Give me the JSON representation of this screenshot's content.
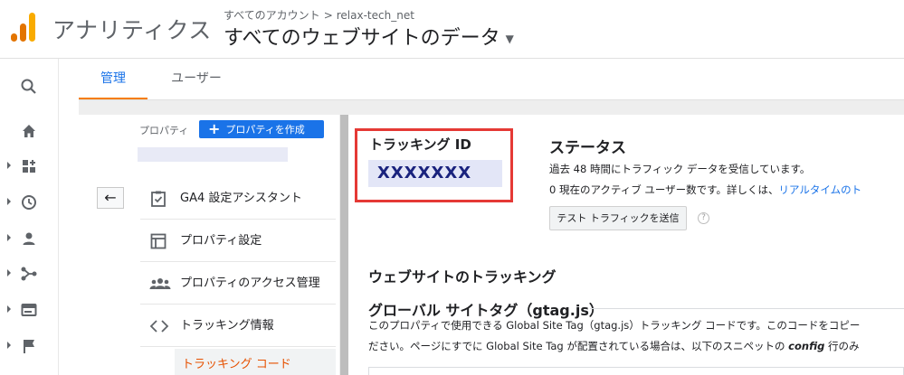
{
  "header": {
    "app_name": "アナリティクス",
    "breadcrumb_account": "すべてのアカウント",
    "breadcrumb_separator": ">",
    "breadcrumb_property": "relax-tech_net",
    "view_title": "すべてのウェブサイトのデータ",
    "logo_colors": [
      "#f9ab00",
      "#e37400",
      "#e37400"
    ]
  },
  "rail": {
    "items": [
      "search-icon",
      "home-icon",
      "customization-icon",
      "reports-realtime-icon",
      "audience-icon",
      "acquisition-icon",
      "behavior-icon",
      "conversions-icon"
    ]
  },
  "tabs": {
    "admin": "管理",
    "users": "ユーザー"
  },
  "property": {
    "label": "プロパティ",
    "create_button": "プロパティを作成",
    "back_icon": "←"
  },
  "menu": {
    "items": [
      {
        "icon": "checklist-icon",
        "label": "GA4 設定アシスタント"
      },
      {
        "icon": "layout-icon",
        "label": "プロパティ設定"
      },
      {
        "icon": "people-icon",
        "label": "プロパティのアクセス管理"
      },
      {
        "icon": "code-icon",
        "label": "トラッキング情報"
      }
    ],
    "sub_item": "トラッキング コード"
  },
  "tracking": {
    "heading": "トラッキング ID",
    "id": "XXXXXXX"
  },
  "status": {
    "heading": "ステータス",
    "line1": "過去 48 時間にトラフィック データを受信しています。",
    "line2_prefix": "0 現在のアクティブ ユーザー数です。詳しくは、",
    "line2_link": "リアルタイムのト",
    "send_button": "テスト トラフィックを送信",
    "help": "?"
  },
  "website_tracking": {
    "heading": "ウェブサイトのトラッキング",
    "gtag_heading": "グローバル サイトタグ（gtag.js）",
    "desc_line1": "このプロパティで使用できる Global Site Tag（gtag.js）トラッキング コードです。このコードをコピー",
    "desc_line2_prefix": "ださい。ページにすでに Global Site Tag が配置されている場合は、以下のスニペットの ",
    "desc_line2_emphasis": "config",
    "desc_line2_suffix": " 行のみ"
  },
  "colors": {
    "accent_blue": "#1a73e8",
    "tab_underline": "#f57c00",
    "active_subitem": "#e65100",
    "highlight_box": "#e53935"
  }
}
